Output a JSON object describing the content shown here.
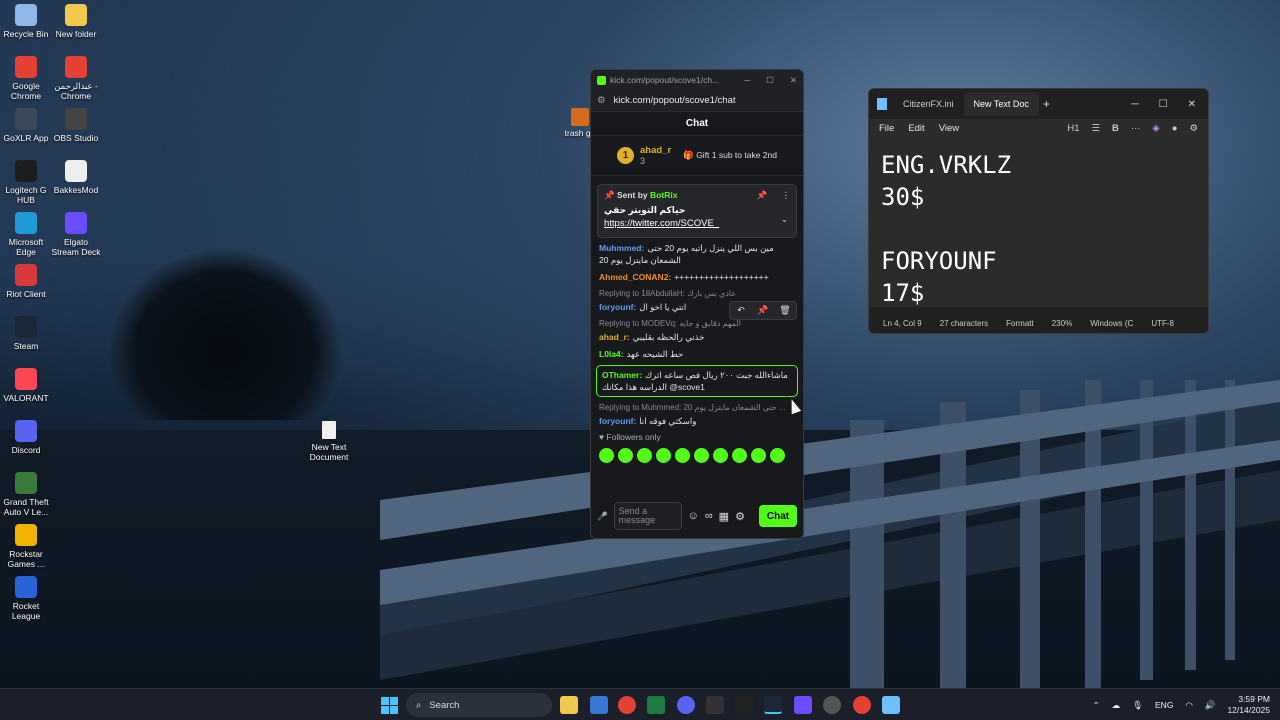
{
  "desktop": {
    "icons": [
      {
        "label": "Recycle Bin",
        "icon": "recycle-bin-icon"
      },
      {
        "label": "New folder",
        "icon": "folder-icon"
      },
      {
        "label": "Google Chrome",
        "icon": "chrome-icon"
      },
      {
        "label": "عبدالرحمن - Chrome",
        "icon": "chrome-icon"
      },
      {
        "label": "GoXLR App",
        "icon": "goxlr-icon"
      },
      {
        "label": "OBS Studio",
        "icon": "obs-icon"
      },
      {
        "label": "Logitech G HUB",
        "icon": "logitech-icon"
      },
      {
        "label": "BakkesMod",
        "icon": "bakkesmod-icon"
      },
      {
        "label": "Microsoft Edge",
        "icon": "edge-icon"
      },
      {
        "label": "Elgato Stream Deck",
        "icon": "streamdeck-icon"
      },
      {
        "label": "Riot Client",
        "icon": "riot-icon"
      },
      {
        "label": "Steam",
        "icon": "steam-icon"
      },
      {
        "label": "VALORANT",
        "icon": "valorant-icon"
      },
      {
        "label": "Discord",
        "icon": "discord-icon"
      },
      {
        "label": "Grand Theft Auto V Le...",
        "icon": "gta-icon"
      },
      {
        "label": "Rockstar Games ...",
        "icon": "rockstar-icon"
      },
      {
        "label": "Rocket League",
        "icon": "rocket-league-icon"
      }
    ],
    "doc_icon": "New Text Document",
    "trash_icon": "trash ga"
  },
  "kick": {
    "title": "kick.com/popout/scove1/ch...",
    "url": "kick.com/popout/scove1/chat",
    "chat_header": "Chat",
    "leader": {
      "rank": "1",
      "name": "ahad_r",
      "count": "3",
      "gift": "Gift 1 sub to take 2nd"
    },
    "pinned": {
      "sent_by": "Sent by",
      "bot": "BotRix",
      "text": "حياكم التويتر حقي",
      "link": "https://twitter.com/SCOVE_"
    },
    "messages": [
      {
        "user": "Muhmmed:",
        "color": "#5b9cf2",
        "text": "مين بس اللي ينزل راتبه يوم 20 حتى الشمعان مايتزل يوم 20",
        "reply": ""
      },
      {
        "user": "Ahmed_CONAN2:",
        "color": "#f08c2c",
        "text": "+++++++++++++++++++",
        "reply": ""
      },
      {
        "user": "foryounf:",
        "color": "#5b9cf2",
        "text": "انتي يا اخو ال",
        "reply": "Replying to 18AbdullaH: عادي بس بارك"
      },
      {
        "user": "ahad_r:",
        "color": "#e0b12a",
        "text": "خذني رالحظه بقليبي",
        "reply": "Replying to MODEVq: المهم دقايق و جايه"
      },
      {
        "user": "L0la4:",
        "color": "#53fc18",
        "text": "حط الشيحه عهد",
        "reply": ""
      },
      {
        "user": "OThamer:",
        "color": "#53fc18",
        "text": "ماشاءالله جبت ٢٠٠ ريال فص ساعه اثرك الدراسه هذا مكانك @scove1",
        "reply": ""
      },
      {
        "user": "foryounf:",
        "color": "#5b9cf2",
        "text": "واسكتي فوقه انا",
        "reply": "Replying to Muhmmed: 20 حتى الشمعان مايتزل يوم ..."
      }
    ],
    "followers_only": "Followers only",
    "input_placeholder": "Send a message",
    "chat_button": "Chat"
  },
  "notepad": {
    "tabs": [
      "CitizenFX.ini",
      "New Text Doc"
    ],
    "menu": [
      "File",
      "Edit",
      "View"
    ],
    "heading": "H1",
    "content": "ENG.VRKLZ\n30$\n\nFORYOUNF\n17$",
    "status": {
      "pos": "Ln 4, Col 9",
      "chars": "27 characters",
      "format": "Formatt",
      "zoom": "230%",
      "eol": "Windows (C",
      "enc": "UTF-8"
    }
  },
  "taskbar": {
    "search": "Search",
    "lang": "ENG",
    "time": "3:59 PM",
    "date": "12/14/2025"
  }
}
